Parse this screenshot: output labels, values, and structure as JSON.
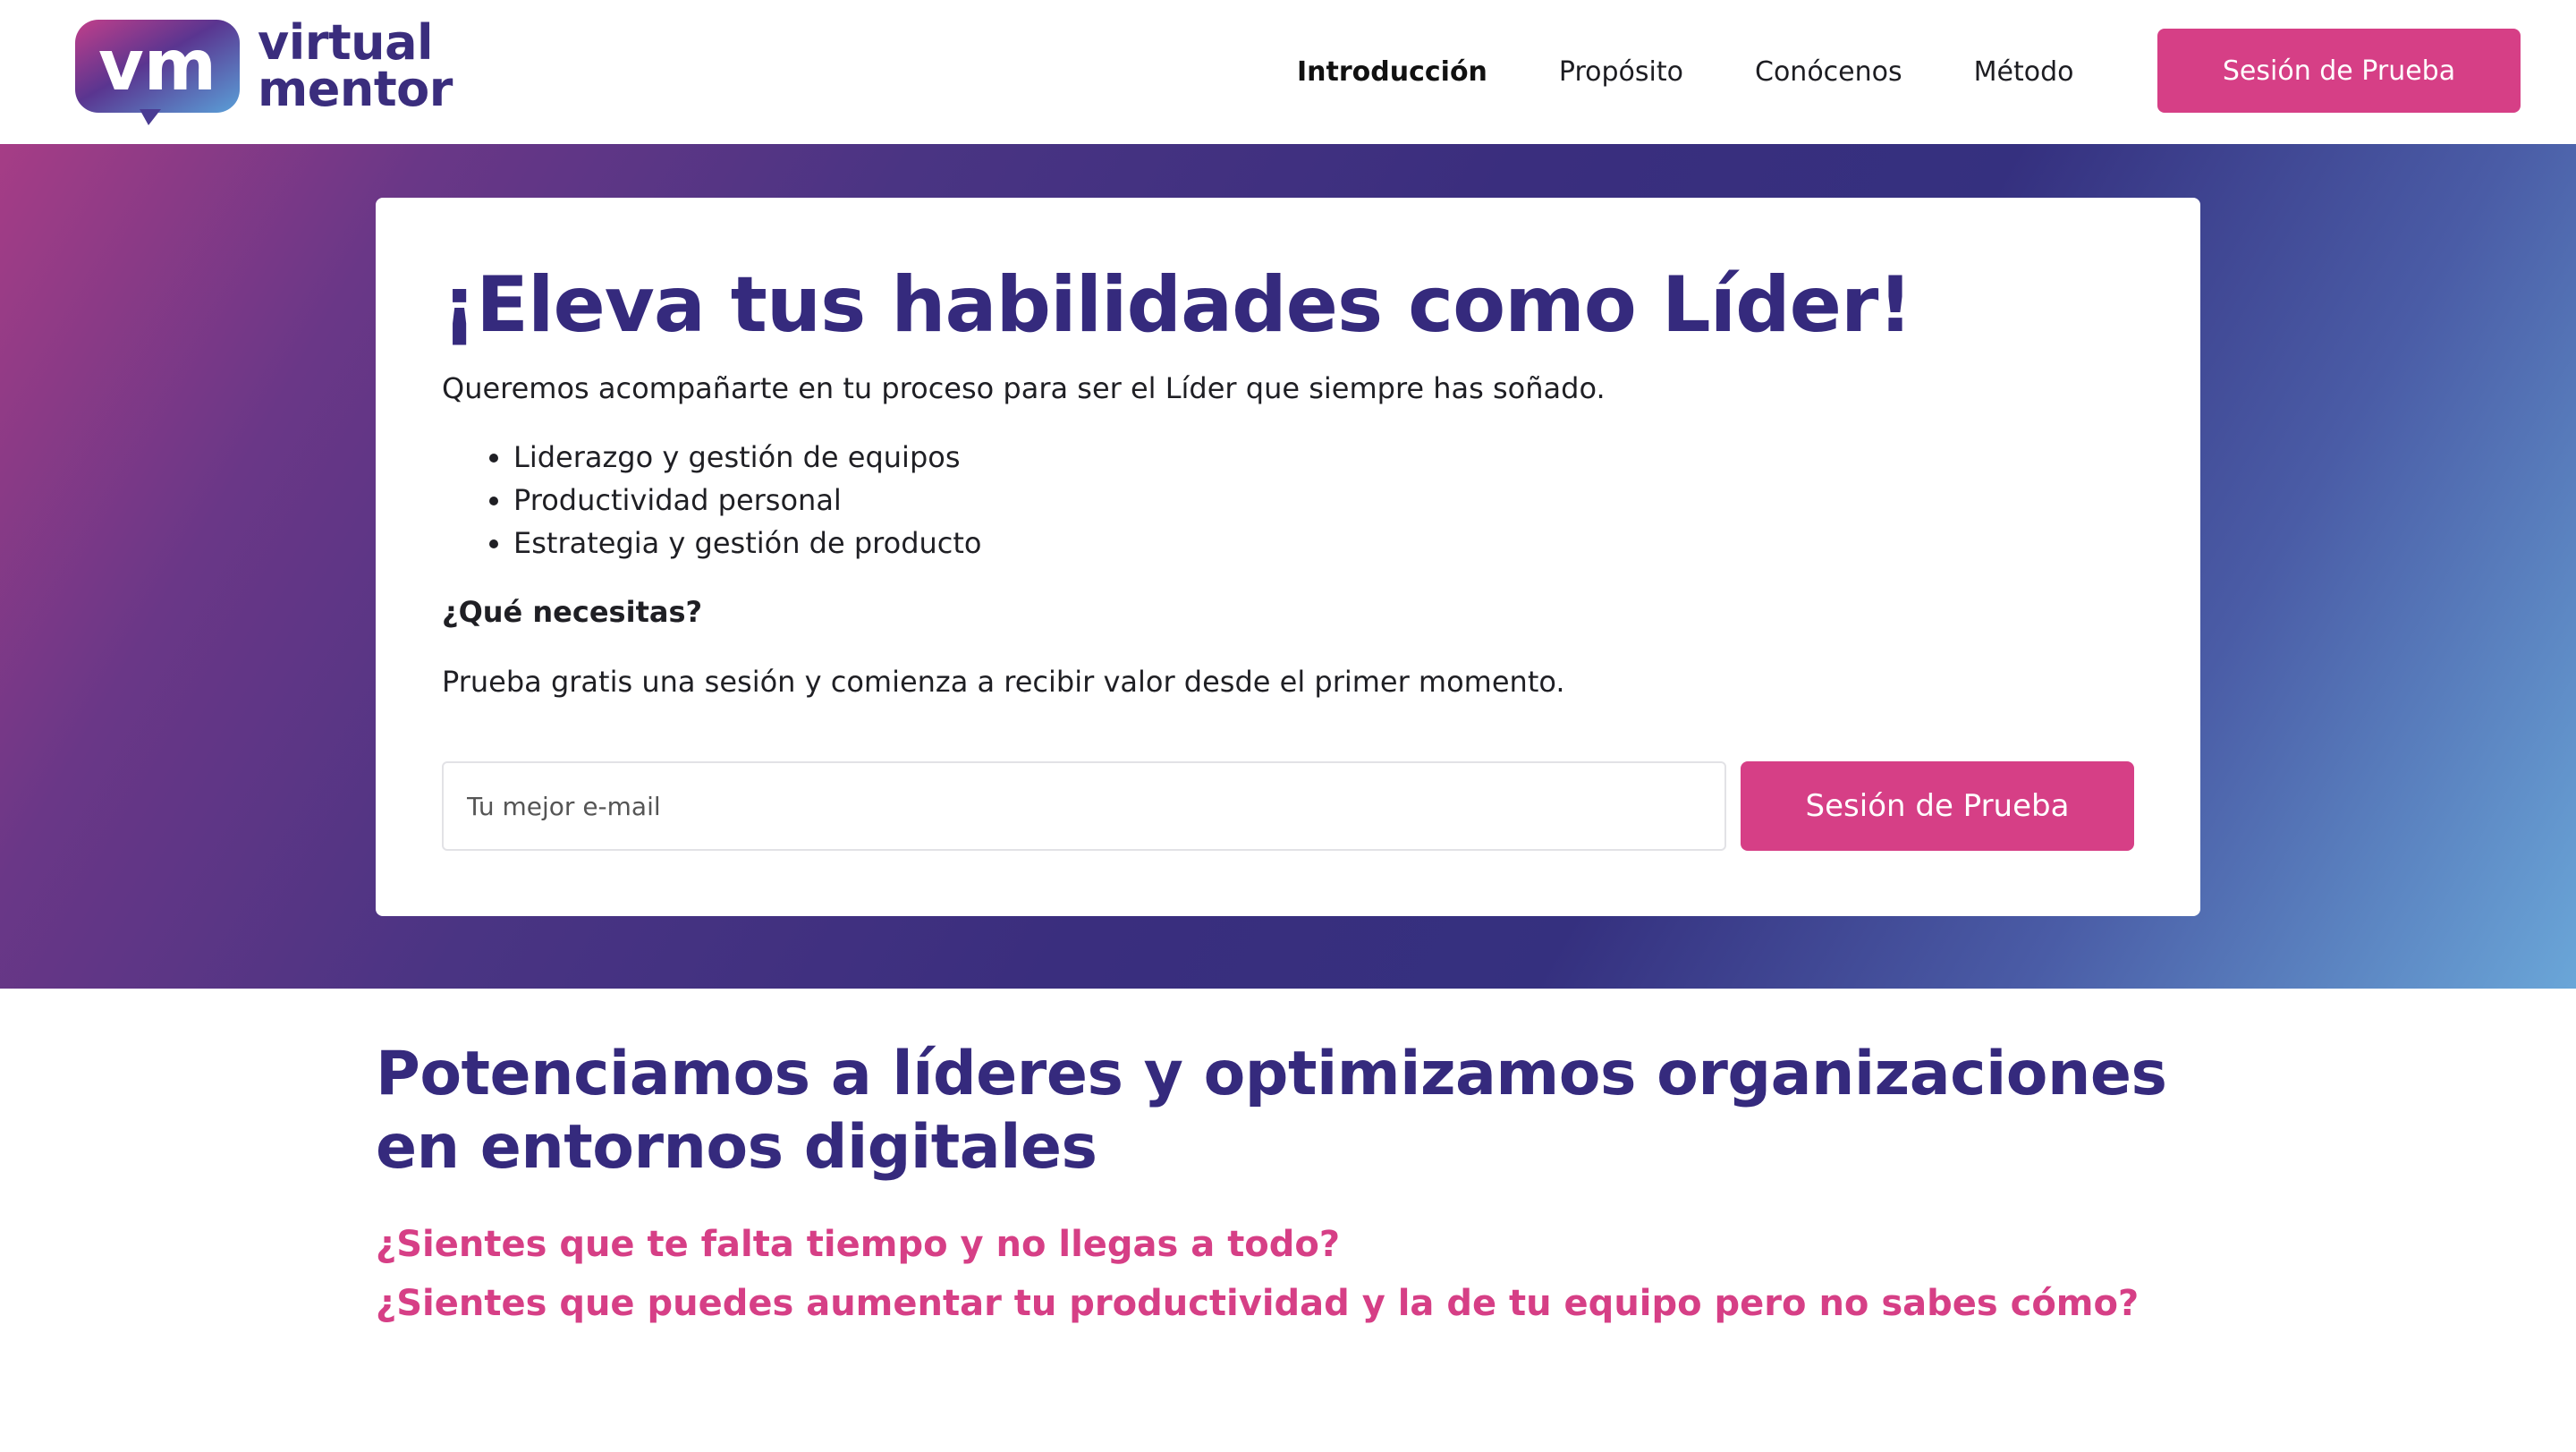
{
  "brand": {
    "logo_line1": "virtual",
    "logo_line2": "mentor",
    "logo_badge_text": "vm",
    "colors": {
      "primary": "#352a7d",
      "accent": "#d63f86",
      "gradient_start": "#a63d86",
      "gradient_end": "#6aa6d8"
    }
  },
  "nav": {
    "items": [
      {
        "label": "Introducción",
        "active": true
      },
      {
        "label": "Propósito",
        "active": false
      },
      {
        "label": "Conócenos",
        "active": false
      },
      {
        "label": "Método",
        "active": false
      }
    ],
    "cta_label": "Sesión de Prueba"
  },
  "hero": {
    "title": "¡Eleva tus habilidades como Líder!",
    "lead": "Queremos acompañarte en tu proceso para ser el Líder que siempre has soñado.",
    "bullets": [
      "Liderazgo y gestión de equipos",
      "Productividad personal",
      "Estrategia y gestión de producto"
    ],
    "question": "¿Qué necesitas?",
    "sub": "Prueba gratis una sesión y comienza a recibir valor desde el primer momento.",
    "email_placeholder": "Tu mejor e-mail",
    "email_value": "",
    "button_label": "Sesión de Prueba"
  },
  "section": {
    "title": "Potenciamos a líderes y optimizamos organizaciones en entornos digitales",
    "questions": [
      "¿Sientes que te falta tiempo y no llegas a todo?",
      "¿Sientes que puedes aumentar tu productividad y la de tu equipo pero no sabes cómo?"
    ]
  }
}
